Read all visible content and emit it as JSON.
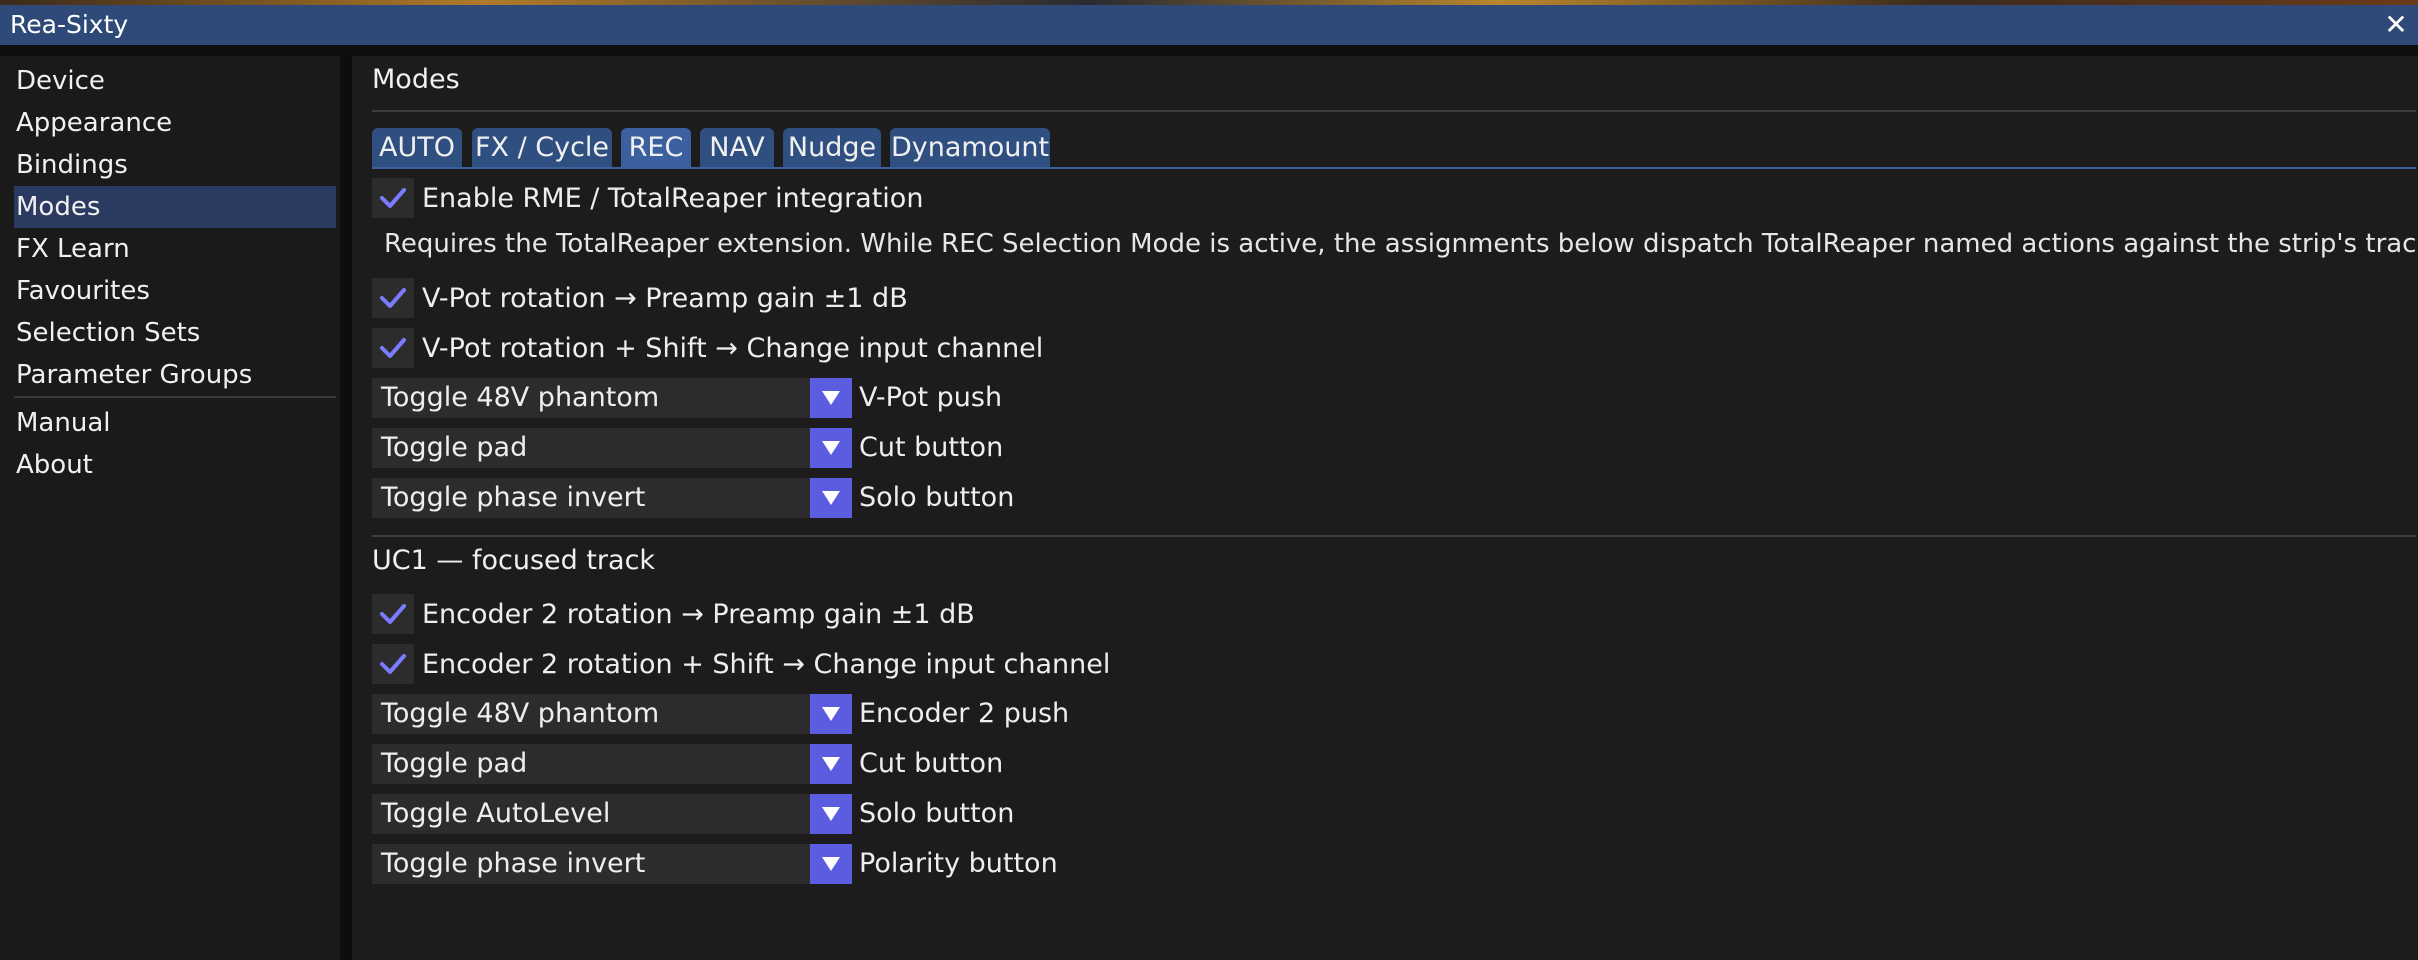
{
  "window": {
    "title": "Rea-Sixty",
    "close_glyph": "✕"
  },
  "sidebar": {
    "items": [
      {
        "label": "Device"
      },
      {
        "label": "Appearance"
      },
      {
        "label": "Bindings"
      },
      {
        "label": "Modes",
        "active": true
      },
      {
        "label": "FX Learn"
      },
      {
        "label": "Favourites"
      },
      {
        "label": "Selection Sets"
      },
      {
        "label": "Parameter Groups"
      },
      {
        "label": "Manual"
      },
      {
        "label": "About"
      }
    ]
  },
  "main": {
    "heading": "Modes",
    "tabs": [
      {
        "label": "AUTO"
      },
      {
        "label": "FX / Cycle"
      },
      {
        "label": "REC",
        "active": true
      },
      {
        "label": "NAV"
      },
      {
        "label": "Nudge"
      },
      {
        "label": "Dynamount"
      }
    ],
    "enable_rme": {
      "label": "Enable RME / TotalReaper integration",
      "checked": true
    },
    "description": "Requires the TotalReaper extension. While REC Selection Mode is active, the assignments below dispatch TotalReaper named actions against the strip's track. \"None\" lea",
    "vpot_rotation": {
      "label": "V-Pot rotation → Preamp gain ±1 dB",
      "checked": true
    },
    "vpot_rotation_shift": {
      "label": "V-Pot rotation + Shift → Change input channel",
      "checked": true
    },
    "combos_top": [
      {
        "value": "Toggle 48V phantom",
        "caption": "V-Pot push"
      },
      {
        "value": "Toggle pad",
        "caption": "Cut button"
      },
      {
        "value": "Toggle phase invert",
        "caption": "Solo button"
      }
    ],
    "uc1_heading": "UC1 — focused track",
    "enc_rotation": {
      "label": "Encoder 2 rotation → Preamp gain ±1 dB",
      "checked": true
    },
    "enc_rotation_shift": {
      "label": "Encoder 2 rotation + Shift → Change input channel",
      "checked": true
    },
    "combos_bottom": [
      {
        "value": "Toggle 48V phantom",
        "caption": "Encoder 2 push"
      },
      {
        "value": "Toggle pad",
        "caption": "Cut button"
      },
      {
        "value": "Toggle AutoLevel",
        "caption": "Solo button"
      },
      {
        "value": "Toggle phase invert",
        "caption": "Polarity button"
      }
    ]
  },
  "colors": {
    "titlebar": "#2f4a78",
    "tab": "#2f4f80",
    "tab_active": "#3a60a0",
    "sidebar_active": "#2a3a60",
    "accent": "#5c5ce0",
    "check": "#7b7bff"
  }
}
